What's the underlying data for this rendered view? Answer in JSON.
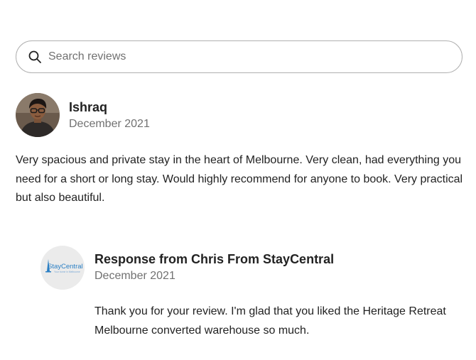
{
  "search": {
    "placeholder": "Search reviews",
    "icon": "search-icon"
  },
  "review": {
    "reviewer_name": "Ishraq",
    "date": "December 2021",
    "text": "Very spacious and private stay in the heart of Melbourne. Very clean, had everything you need for a short or long stay. Would highly recommend for anyone to book. Very practical but also beautiful."
  },
  "response": {
    "title": "Response from Chris From StayCentral",
    "date": "December 2021",
    "text": "Thank you for your review. I'm glad that you liked the Heritage Retreat Melbourne converted warehouse so much.",
    "logo": {
      "brand": "StayCentral",
      "tagline": "Your home in Melbourne"
    }
  },
  "colors": {
    "text_primary": "#222222",
    "text_secondary": "#717171",
    "border": "#b0b0b0",
    "logo_bg": "#ebebeb",
    "brand_blue": "#2a7fc4"
  }
}
